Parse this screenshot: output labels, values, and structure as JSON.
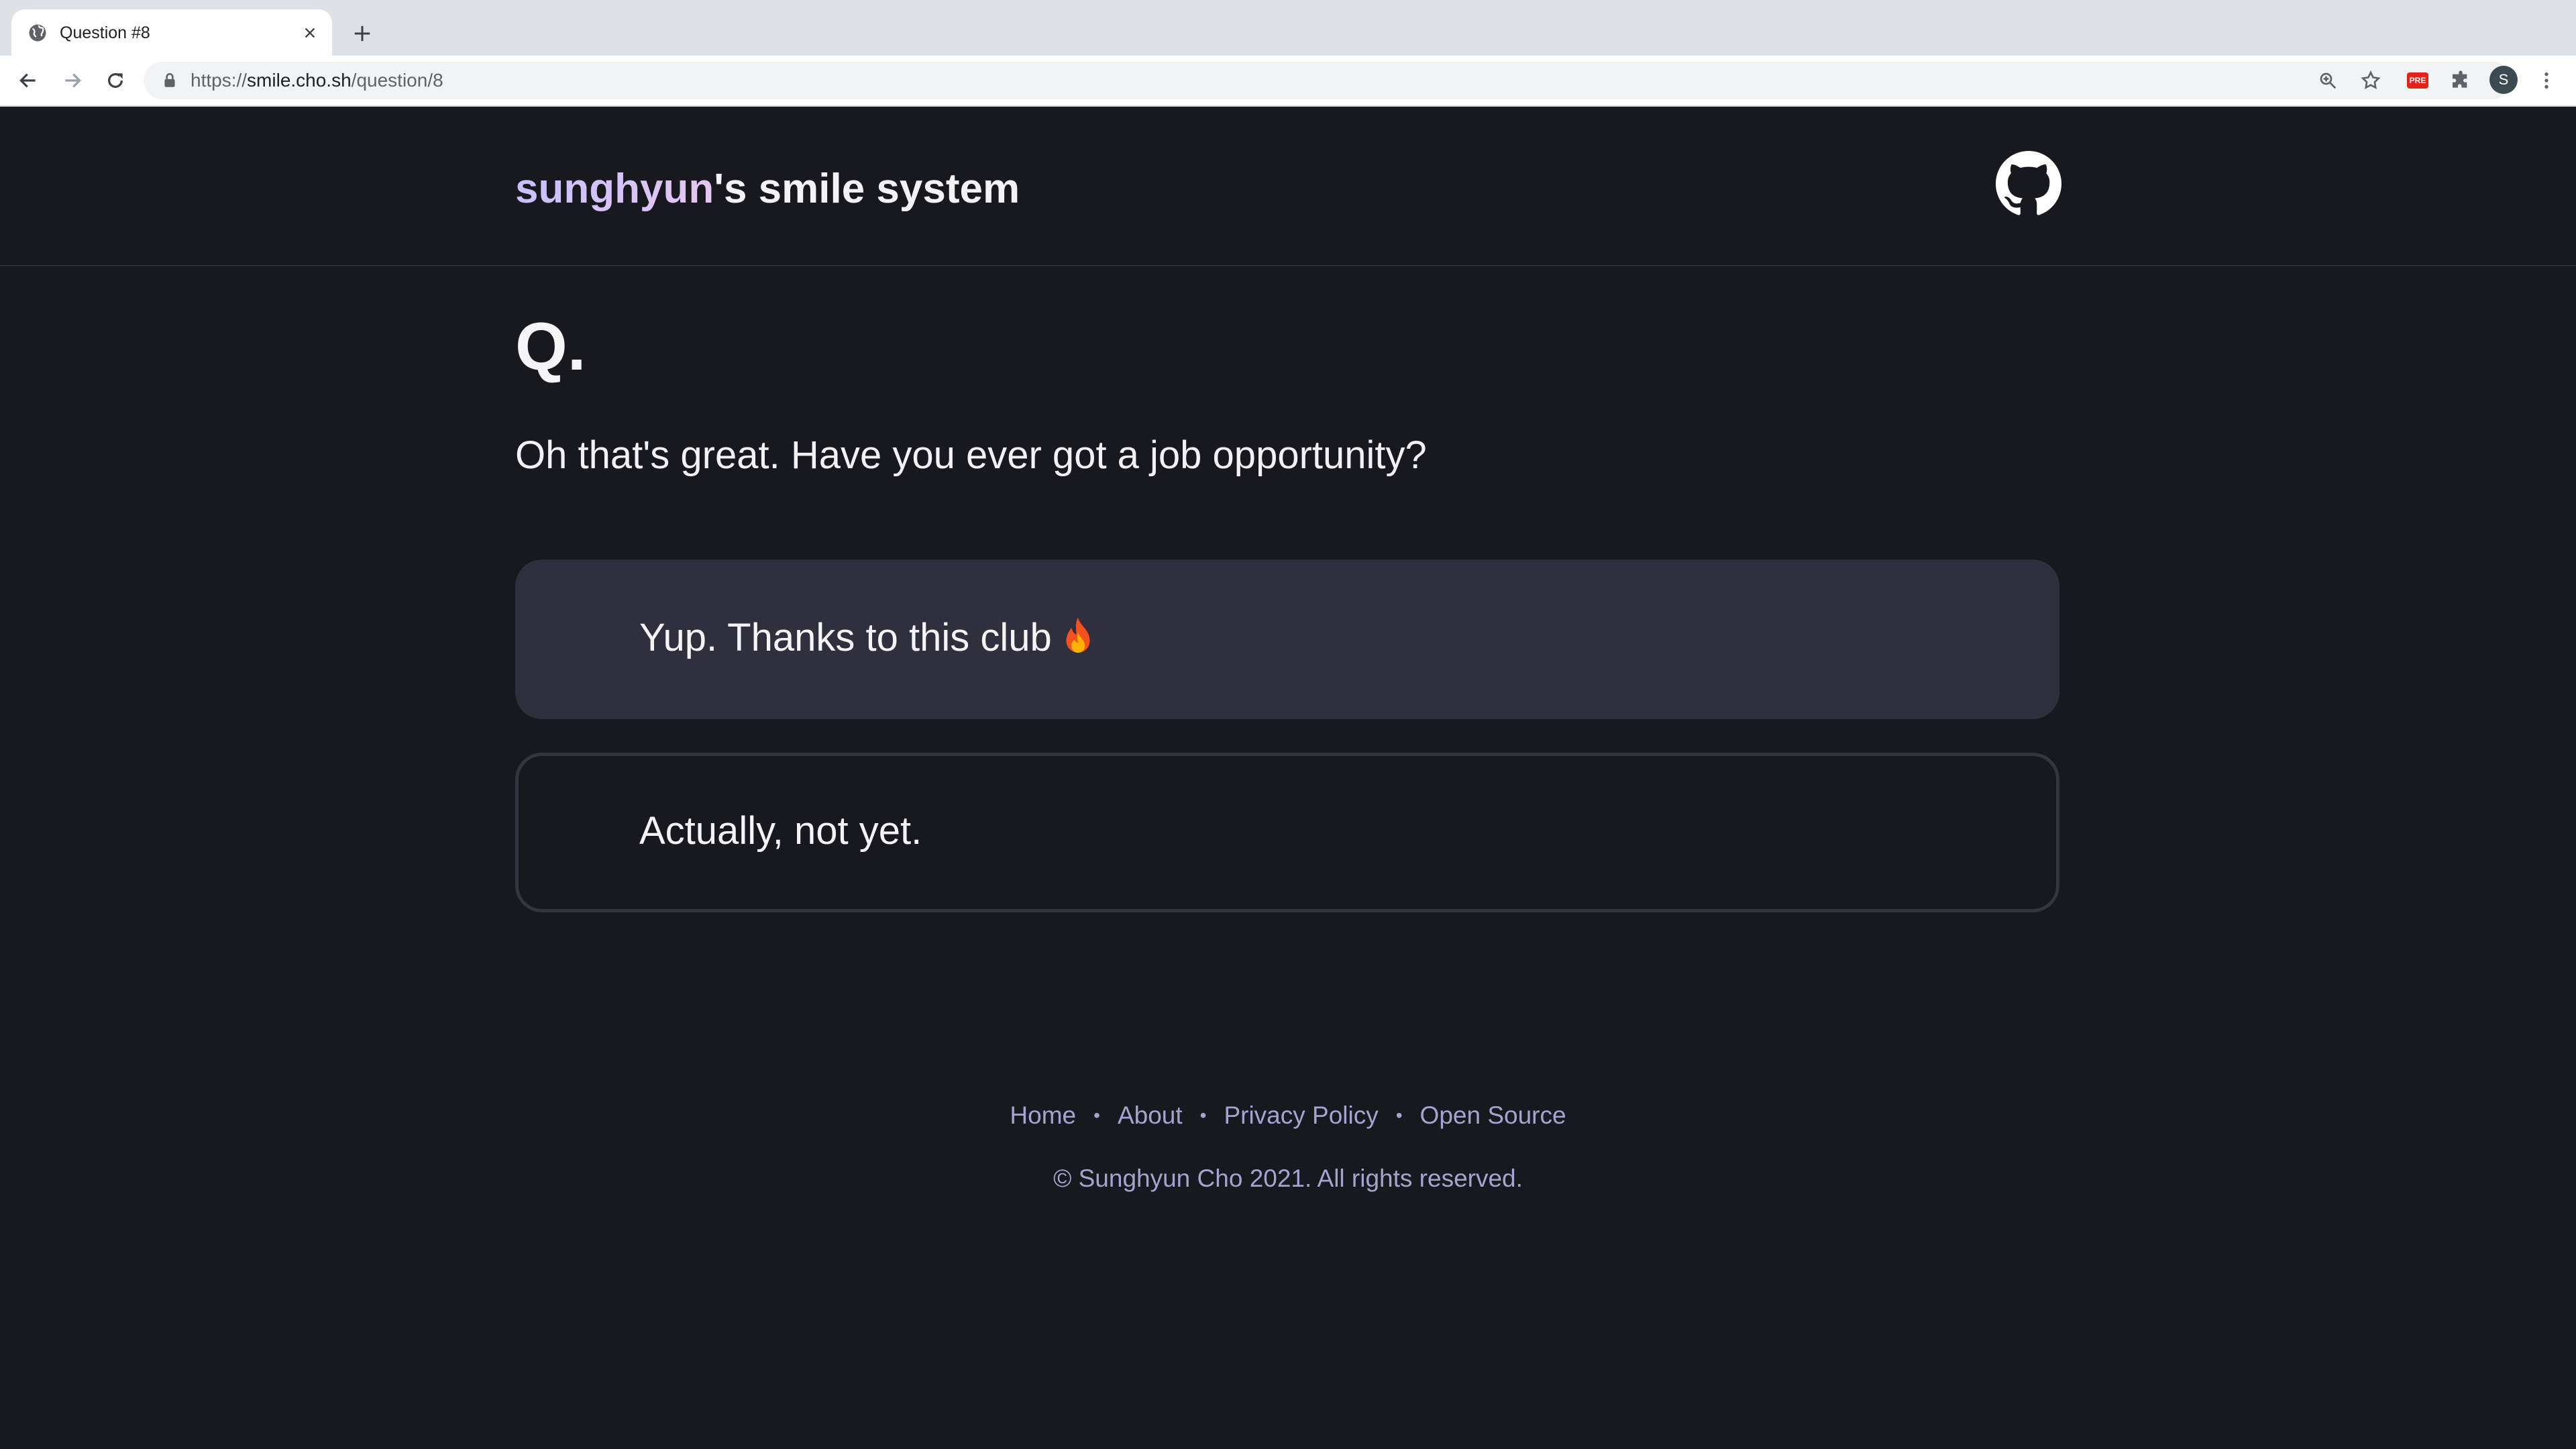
{
  "browser": {
    "tab_title": "Question #8",
    "url_scheme": "https://",
    "url_host": "smile.cho.sh",
    "url_path": "/question/8",
    "profile_initial": "S",
    "extension_badge": "PRE"
  },
  "site": {
    "title_name": "sunghyun",
    "title_rest": "'s smile system"
  },
  "question": {
    "marker": "Q.",
    "text": "Oh that's great. Have you ever got a job opportunity?"
  },
  "answers": [
    {
      "label": "Yup. Thanks to this club",
      "emoji": "fire"
    },
    {
      "label": "Actually, not yet."
    }
  ],
  "footer": {
    "links": [
      "Home",
      "About",
      "Privacy Policy",
      "Open Source"
    ],
    "separator": "•",
    "copyright": "© Sunghyun Cho 2021. All rights reserved."
  },
  "colors": {
    "page_bg": "#18191f",
    "selected_answer_bg": "#2f2f3e",
    "footer_text": "#a7a3d0"
  }
}
